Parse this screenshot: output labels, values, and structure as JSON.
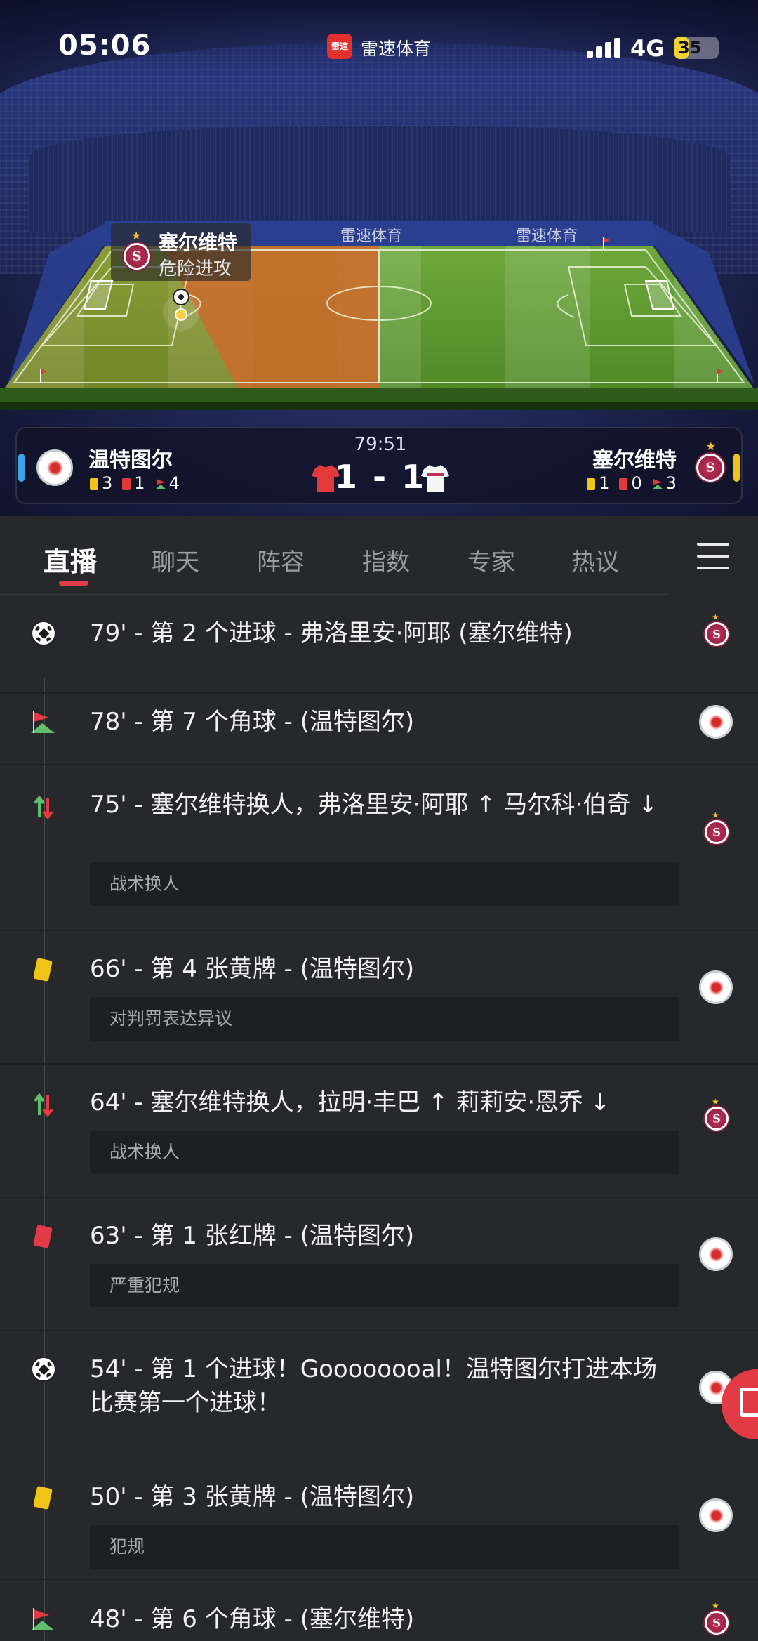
{
  "status_bar": {
    "time": "05:06",
    "app_name": "雷速体育",
    "app_badge": "雷速",
    "network": "4G",
    "battery": "35",
    "battery_level": 0.35,
    "accent": "#f2d336"
  },
  "field": {
    "board_texts": [
      "雷速体育",
      "雷速体育",
      "雷速体育",
      "雷速体育"
    ],
    "event_team": "塞尔维特",
    "event_desc": "危险进攻",
    "attack_color": "#d06a2a"
  },
  "match": {
    "time": "79:51",
    "score": "1 - 1",
    "home": {
      "name": "温特图尔",
      "yellow": "3",
      "red": "1",
      "corners": "4",
      "side_color": "#3aa6ea",
      "jersey_color": "#e23a3a"
    },
    "away": {
      "name": "塞尔维特",
      "yellow": "1",
      "red": "0",
      "corners": "3",
      "side_color": "#f0c419",
      "jersey_color": "#f5f5f5",
      "crest_letter": "S"
    }
  },
  "tabs": [
    "直播",
    "聊天",
    "阵容",
    "指数",
    "专家",
    "热议"
  ],
  "active_tab": "直播",
  "events": [
    {
      "icon": "ball-icon",
      "text": "79' - 第 2 个进球 - 弗洛里安·阿耶 (塞尔维特)",
      "note": "",
      "team": "away"
    },
    {
      "icon": "corner-flag-icon",
      "text": "78' - 第 7 个角球 - (温特图尔)",
      "note": "",
      "team": "home"
    },
    {
      "icon": "substitution-icon",
      "text": "75' - 塞尔维特换人，弗洛里安·阿耶 ↑ 马尔科·伯奇 ↓",
      "note": "战术换人",
      "team": "away"
    },
    {
      "icon": "yellow-card-icon",
      "text": "66' - 第 4 张黄牌 - (温特图尔)",
      "note": "对判罚表达异议",
      "team": "home"
    },
    {
      "icon": "substitution-icon",
      "text": "64' - 塞尔维特换人，拉明·丰巴 ↑ 莉莉安·恩乔 ↓",
      "note": "战术换人",
      "team": "away"
    },
    {
      "icon": "red-card-icon",
      "text": "63' - 第 1 张红牌 - (温特图尔)",
      "note": "严重犯规",
      "team": "home"
    },
    {
      "icon": "ball-icon",
      "text": "54' - 第 1 个进球！Goooooooal！温特图尔打进本场比赛第一个进球！",
      "note": "",
      "team": "home"
    },
    {
      "icon": "yellow-card-icon",
      "text": "50' - 第 3 张黄牌 - (温特图尔)",
      "note": "犯规",
      "team": "home"
    },
    {
      "icon": "corner-flag-icon",
      "text": "48' - 第 6 个角球 - (塞尔维特)",
      "note": "",
      "team": "away"
    }
  ]
}
